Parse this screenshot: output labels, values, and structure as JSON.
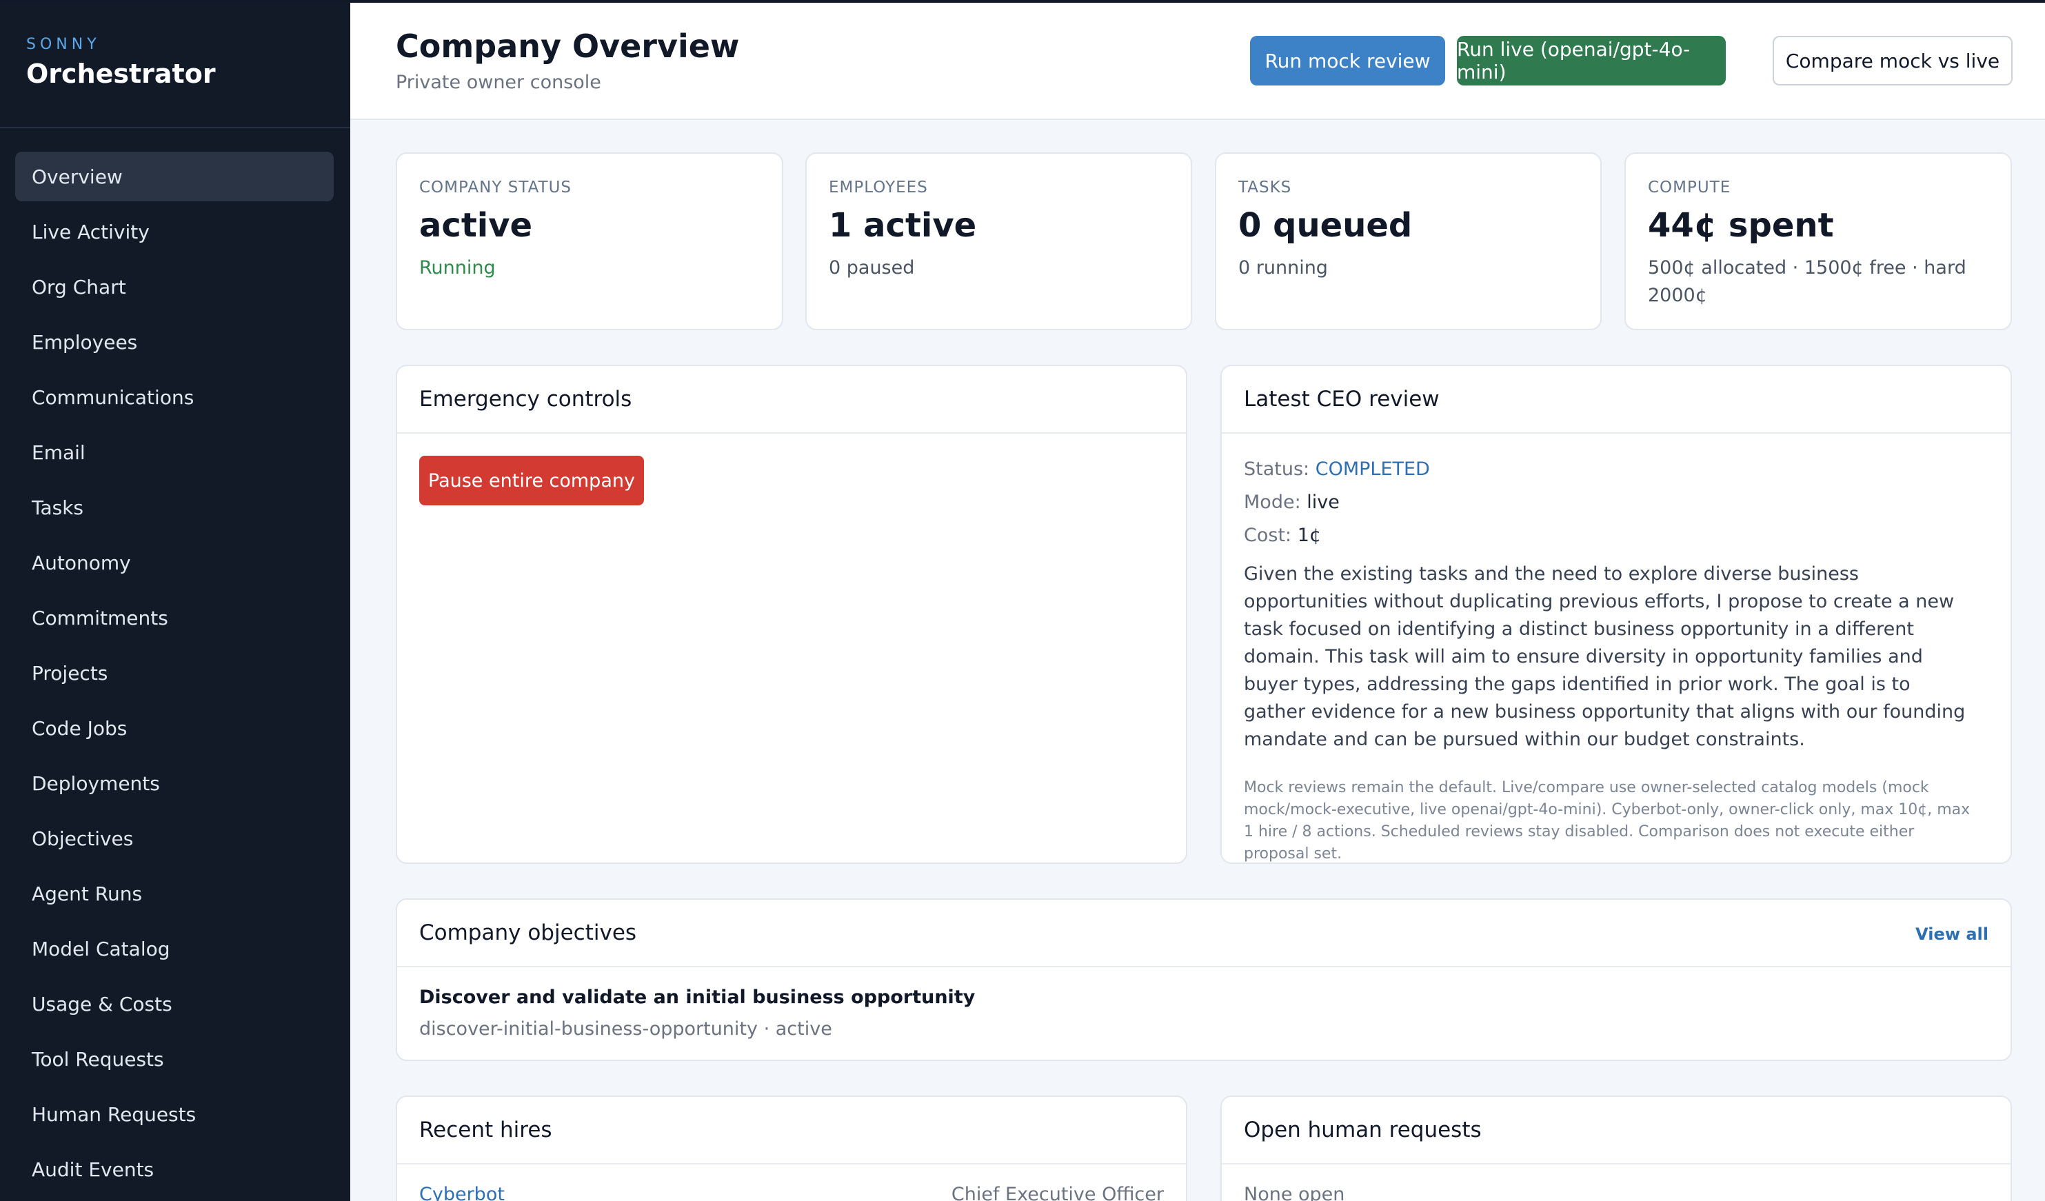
{
  "brand": {
    "small": "SONNY",
    "title": "Orchestrator"
  },
  "sidebar": {
    "items": [
      {
        "label": "Overview",
        "active": true
      },
      {
        "label": "Live Activity"
      },
      {
        "label": "Org Chart"
      },
      {
        "label": "Employees"
      },
      {
        "label": "Communications"
      },
      {
        "label": "Email"
      },
      {
        "label": "Tasks"
      },
      {
        "label": "Autonomy"
      },
      {
        "label": "Commitments"
      },
      {
        "label": "Projects"
      },
      {
        "label": "Code Jobs"
      },
      {
        "label": "Deployments"
      },
      {
        "label": "Objectives"
      },
      {
        "label": "Agent Runs"
      },
      {
        "label": "Model Catalog"
      },
      {
        "label": "Usage & Costs"
      },
      {
        "label": "Tool Requests"
      },
      {
        "label": "Human Requests"
      },
      {
        "label": "Audit Events"
      }
    ]
  },
  "header": {
    "title": "Company Overview",
    "subtitle": "Private owner console",
    "buttons": {
      "mock": "Run mock review",
      "live": "Run live (openai/gpt-4o-mini)",
      "compare": "Compare mock vs live"
    }
  },
  "stats": [
    {
      "label": "COMPANY STATUS",
      "value": "active",
      "sub": "Running"
    },
    {
      "label": "EMPLOYEES",
      "value": "1 active",
      "sub": "0 paused"
    },
    {
      "label": "TASKS",
      "value": "0 queued",
      "sub": "0 running"
    },
    {
      "label": "COMPUTE",
      "value": "44¢ spent",
      "sub": "500¢ allocated · 1500¢ free · hard 2000¢"
    }
  ],
  "emergency": {
    "title": "Emergency controls",
    "button": "Pause entire company"
  },
  "ceo_review": {
    "title": "Latest CEO review",
    "status_label": "Status: ",
    "status_value": "COMPLETED",
    "mode_label": "Mode: ",
    "mode_value": "live",
    "cost_label": "Cost: ",
    "cost_value": "1¢",
    "text": "Given the existing tasks and the need to explore diverse business opportunities without duplicating previous efforts, I propose to create a new task focused on identifying a distinct business opportunity in a different domain. This task will aim to ensure diversity in opportunity families and buyer types, addressing the gaps identified in prior work. The goal is to gather evidence for a new business opportunity that aligns with our founding mandate and can be pursued within our budget constraints.",
    "note": "Mock reviews remain the default. Live/compare use owner-selected catalog models (mock mock/mock-executive, live openai/gpt-4o-mini). Cyberbot-only, owner-click only, max 10¢, max 1 hire / 8 actions. Scheduled reviews stay disabled. Comparison does not execute either proposal set."
  },
  "objectives": {
    "title": "Company objectives",
    "view_all": "View all",
    "items": [
      {
        "name": "Discover and validate an initial business opportunity",
        "meta": "discover-initial-business-opportunity · active"
      }
    ]
  },
  "recent_hires": {
    "title": "Recent hires",
    "items": [
      {
        "name": "Cyberbot",
        "role": "Chief Executive Officer"
      }
    ]
  },
  "human_requests": {
    "title": "Open human requests",
    "empty": "None open"
  }
}
